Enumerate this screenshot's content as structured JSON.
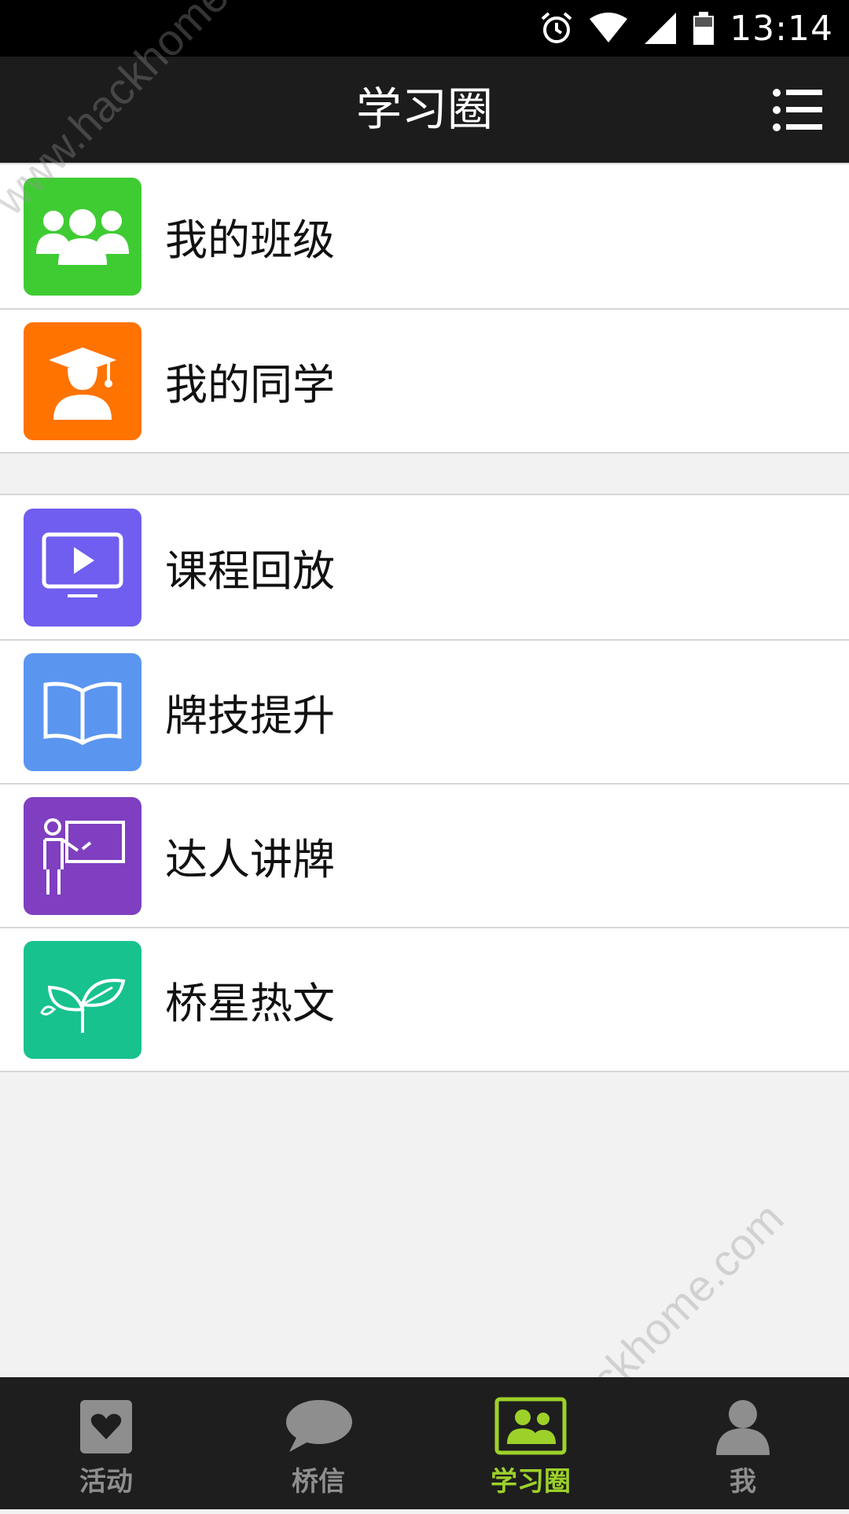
{
  "status_bar": {
    "time": "13:14"
  },
  "header": {
    "title": "学习圈"
  },
  "group1": [
    {
      "label": "我的班级",
      "color": "#3fcc33",
      "icon": "group-users-icon"
    },
    {
      "label": "我的同学",
      "color": "#ff7300",
      "icon": "graduate-icon"
    }
  ],
  "group2": [
    {
      "label": "课程回放",
      "color": "#6f5ef0",
      "icon": "play-screen-icon"
    },
    {
      "label": "牌技提升",
      "color": "#5a95f0",
      "icon": "open-book-icon"
    },
    {
      "label": "达人讲牌",
      "color": "#7f3fc0",
      "icon": "teacher-board-icon"
    },
    {
      "label": "桥星热文",
      "color": "#17c28f",
      "icon": "leaf-sprout-icon"
    }
  ],
  "tabs": [
    {
      "label": "活动",
      "icon": "heart-card-icon",
      "active": false
    },
    {
      "label": "桥信",
      "icon": "chat-bubble-icon",
      "active": false
    },
    {
      "label": "学习圈",
      "icon": "study-circle-icon",
      "active": true
    },
    {
      "label": "我",
      "icon": "person-icon",
      "active": false
    }
  ],
  "watermark": "www.hackhome.com",
  "accent_color": "#9dd12a"
}
